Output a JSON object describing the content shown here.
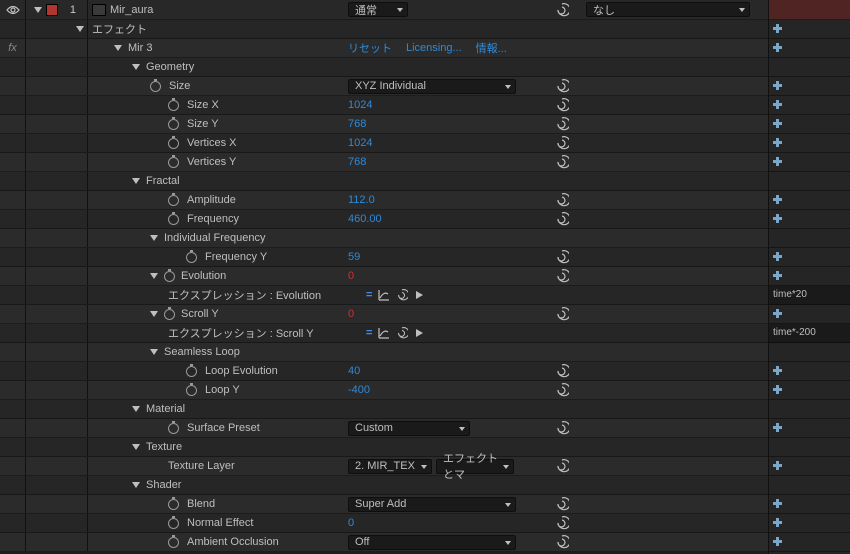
{
  "layer": {
    "index": "1",
    "name": "Mir_aura",
    "mode": "通常",
    "trackMatte": "なし"
  },
  "effectsHeader": "エフェクト",
  "effect": {
    "name": "Mir 3",
    "reset": "リセット",
    "licensing": "Licensing...",
    "info": "情報...",
    "groups": {
      "geometry": {
        "label": "Geometry",
        "size": {
          "label": "Size",
          "value": "XYZ Individual"
        },
        "sizeX": {
          "label": "Size X",
          "value": "1024"
        },
        "sizeY": {
          "label": "Size Y",
          "value": "768"
        },
        "vertX": {
          "label": "Vertices X",
          "value": "1024"
        },
        "vertY": {
          "label": "Vertices Y",
          "value": "768"
        }
      },
      "fractal": {
        "label": "Fractal",
        "amplitude": {
          "label": "Amplitude",
          "value": "112.0"
        },
        "frequency": {
          "label": "Frequency",
          "value": "460.00"
        },
        "indFreq": {
          "label": "Individual Frequency",
          "freqY": {
            "label": "Frequency Y",
            "value": "59"
          }
        },
        "evolution": {
          "label": "Evolution",
          "value": "0",
          "exprLabel": "エクスプレッション : Evolution",
          "exprText": "time*20"
        },
        "scrollY": {
          "label": "Scroll Y",
          "value": "0",
          "exprLabel": "エクスプレッション : Scroll Y",
          "exprText": "time*-200"
        },
        "seamless": {
          "label": "Seamless Loop",
          "loopEvo": {
            "label": "Loop Evolution",
            "value": "40"
          },
          "loopY": {
            "label": "Loop Y",
            "value": "-400"
          }
        }
      },
      "material": {
        "label": "Material",
        "surfacePreset": {
          "label": "Surface Preset",
          "value": "Custom"
        }
      },
      "texture": {
        "label": "Texture",
        "textureLayer": {
          "label": "Texture Layer",
          "value": "2. MIR_TEX",
          "mode": "エフェクトとマ"
        }
      },
      "shader": {
        "label": "Shader",
        "blend": {
          "label": "Blend",
          "value": "Super Add"
        },
        "normalEffect": {
          "label": "Normal Effect",
          "value": "0"
        },
        "ao": {
          "label": "Ambient Occlusion",
          "value": "Off"
        }
      }
    }
  }
}
